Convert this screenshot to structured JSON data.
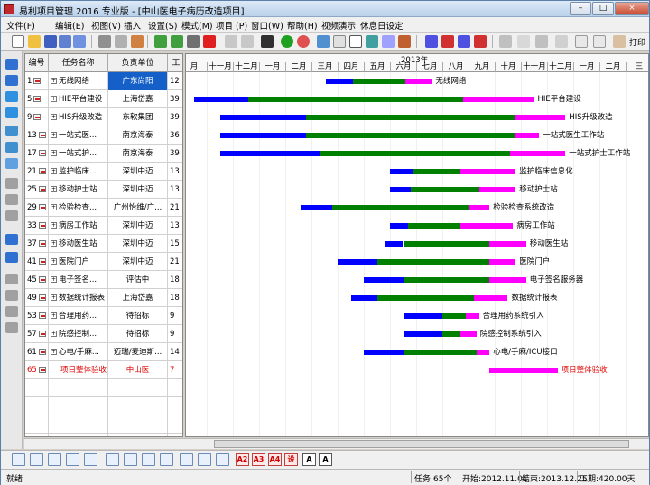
{
  "window": {
    "title": "易利项目管理 2016 专业版 - [中山医电子病历改造项目]",
    "controls": [
      "–",
      "□",
      "×"
    ]
  },
  "menu": [
    "文件(F)",
    "编辑(E)",
    "视图(V)",
    "插入",
    "设置(S)",
    "模式(M)",
    "项目 (P)",
    "窗口(W)",
    "帮助(H)",
    "视频演示",
    "休息日设定"
  ],
  "toolbar": {
    "print_label": "打印"
  },
  "grid": {
    "headers": {
      "id": "编号",
      "name": "任务名称",
      "unit": "负责单位",
      "duration": "工"
    },
    "rows": [
      {
        "id": "1",
        "name": "无线网络",
        "unit": "广东尚阳",
        "duration": "12",
        "selected": true
      },
      {
        "id": "5",
        "name": "HIE平台建设",
        "unit": "上海岱嘉",
        "duration": "39"
      },
      {
        "id": "9",
        "name": "HIS升级改造",
        "unit": "东软集团",
        "duration": "39"
      },
      {
        "id": "13",
        "name": "一站式医...",
        "unit": "南京海泰",
        "duration": "36"
      },
      {
        "id": "17",
        "name": "一站式护...",
        "unit": "南京海泰",
        "duration": "39"
      },
      {
        "id": "21",
        "name": "监护临床...",
        "unit": "深圳中迈",
        "duration": "13"
      },
      {
        "id": "25",
        "name": "移动护士站",
        "unit": "深圳中迈",
        "duration": "13"
      },
      {
        "id": "29",
        "name": "检验检查...",
        "unit": "广州怡维/广...",
        "duration": "21"
      },
      {
        "id": "33",
        "name": "病房工作站",
        "unit": "深圳中迈",
        "duration": "13"
      },
      {
        "id": "37",
        "name": "移动医生站",
        "unit": "深圳中迈",
        "duration": "15"
      },
      {
        "id": "41",
        "name": "医院门户",
        "unit": "深圳中迈",
        "duration": "21"
      },
      {
        "id": "45",
        "name": "电子签名...",
        "unit": "评估中",
        "duration": "18"
      },
      {
        "id": "49",
        "name": "数据统计报表",
        "unit": "上海岱嘉",
        "duration": "18"
      },
      {
        "id": "53",
        "name": "合理用药...",
        "unit": "待招标",
        "duration": "9"
      },
      {
        "id": "57",
        "name": "院感控制...",
        "unit": "待招标",
        "duration": "9"
      },
      {
        "id": "61",
        "name": "心电/手麻...",
        "unit": "迈瑞/麦迪斯...",
        "duration": "14"
      },
      {
        "id": "65",
        "name": "项目整体验收",
        "unit": "中山医",
        "duration": "7",
        "red": true
      }
    ]
  },
  "gantt": {
    "year_label": "2013年",
    "months": [
      "月",
      "十一月",
      "十二月",
      "一月",
      "二月",
      "三月",
      "四月",
      "五月",
      "六月",
      "七月",
      "八月",
      "九月",
      "十月",
      "十一月",
      "十二月",
      "一月",
      "二月",
      "三"
    ],
    "colors": {
      "blue": "#0000ff",
      "green": "#008000",
      "magenta": "#ff00ff"
    },
    "tasks": [
      {
        "label": "无线网络",
        "segments": [
          {
            "start": 5.55,
            "end": 6.6,
            "color": "blue"
          },
          {
            "start": 6.6,
            "end": 8.6,
            "color": "green"
          },
          {
            "start": 8.6,
            "end": 9.6,
            "color": "magenta"
          }
        ]
      },
      {
        "label": "HIE平台建设",
        "segments": [
          {
            "start": 0.5,
            "end": 2.6,
            "color": "blue"
          },
          {
            "start": 2.6,
            "end": 10.8,
            "color": "green"
          },
          {
            "start": 10.8,
            "end": 13.5,
            "color": "magenta"
          }
        ]
      },
      {
        "label": "HIS升级改造",
        "segments": [
          {
            "start": 1.5,
            "end": 4.8,
            "color": "blue"
          },
          {
            "start": 4.8,
            "end": 12.8,
            "color": "green"
          },
          {
            "start": 12.8,
            "end": 14.7,
            "color": "magenta"
          }
        ]
      },
      {
        "label": "一站式医生工作站",
        "segments": [
          {
            "start": 1.5,
            "end": 4.8,
            "color": "blue"
          },
          {
            "start": 4.8,
            "end": 12.8,
            "color": "green"
          },
          {
            "start": 12.8,
            "end": 13.7,
            "color": "magenta"
          }
        ]
      },
      {
        "label": "一站式护士工作站",
        "segments": [
          {
            "start": 1.5,
            "end": 5.3,
            "color": "blue"
          },
          {
            "start": 5.3,
            "end": 12.6,
            "color": "green"
          },
          {
            "start": 12.6,
            "end": 14.7,
            "color": "magenta"
          }
        ]
      },
      {
        "label": "监护临床信息化",
        "segments": [
          {
            "start": 8.0,
            "end": 8.9,
            "color": "blue"
          },
          {
            "start": 8.9,
            "end": 10.7,
            "color": "green"
          },
          {
            "start": 10.7,
            "end": 12.8,
            "color": "magenta"
          }
        ]
      },
      {
        "label": "移动护士站",
        "segments": [
          {
            "start": 8.0,
            "end": 8.8,
            "color": "blue"
          },
          {
            "start": 8.8,
            "end": 11.4,
            "color": "green"
          },
          {
            "start": 11.4,
            "end": 12.8,
            "color": "magenta"
          }
        ]
      },
      {
        "label": "检验检查系统改造",
        "segments": [
          {
            "start": 4.6,
            "end": 5.8,
            "color": "blue"
          },
          {
            "start": 5.8,
            "end": 11.0,
            "color": "green"
          },
          {
            "start": 11.0,
            "end": 11.8,
            "color": "magenta"
          }
        ]
      },
      {
        "label": "病房工作站",
        "segments": [
          {
            "start": 8.0,
            "end": 8.7,
            "color": "blue"
          },
          {
            "start": 8.7,
            "end": 10.7,
            "color": "green"
          },
          {
            "start": 10.7,
            "end": 12.7,
            "color": "magenta"
          }
        ]
      },
      {
        "label": "移动医生站",
        "segments": [
          {
            "start": 7.8,
            "end": 8.5,
            "color": "blue"
          },
          {
            "start": 8.5,
            "end": 11.8,
            "color": "green"
          },
          {
            "start": 11.8,
            "end": 13.2,
            "color": "magenta"
          }
        ]
      },
      {
        "label": "医院门户",
        "segments": [
          {
            "start": 6.0,
            "end": 7.5,
            "color": "blue"
          },
          {
            "start": 7.5,
            "end": 11.8,
            "color": "green"
          },
          {
            "start": 11.8,
            "end": 12.8,
            "color": "magenta"
          }
        ]
      },
      {
        "label": "电子签名服务器",
        "segments": [
          {
            "start": 7.0,
            "end": 8.5,
            "color": "blue"
          },
          {
            "start": 8.5,
            "end": 11.8,
            "color": "green"
          },
          {
            "start": 11.8,
            "end": 13.2,
            "color": "magenta"
          }
        ]
      },
      {
        "label": "数据统计报表",
        "segments": [
          {
            "start": 6.5,
            "end": 7.5,
            "color": "blue"
          },
          {
            "start": 7.5,
            "end": 11.2,
            "color": "green"
          },
          {
            "start": 11.2,
            "end": 12.5,
            "color": "magenta"
          }
        ]
      },
      {
        "label": "合理用药系统引入",
        "segments": [
          {
            "start": 8.5,
            "end": 10.0,
            "color": "blue"
          },
          {
            "start": 10.0,
            "end": 10.9,
            "color": "green"
          },
          {
            "start": 10.9,
            "end": 11.4,
            "color": "magenta"
          }
        ]
      },
      {
        "label": "院感控制系统引入",
        "segments": [
          {
            "start": 8.5,
            "end": 10.0,
            "color": "blue"
          },
          {
            "start": 10.0,
            "end": 10.7,
            "color": "green"
          },
          {
            "start": 10.7,
            "end": 11.3,
            "color": "magenta"
          }
        ]
      },
      {
        "label": "心电/手麻/ICU接口",
        "segments": [
          {
            "start": 7.0,
            "end": 8.5,
            "color": "blue"
          },
          {
            "start": 8.5,
            "end": 11.3,
            "color": "green"
          },
          {
            "start": 11.3,
            "end": 11.8,
            "color": "magenta"
          }
        ]
      },
      {
        "label": "项目整体验收",
        "red": true,
        "segments": [
          {
            "start": 11.8,
            "end": 14.4,
            "color": "magenta"
          }
        ]
      }
    ]
  },
  "status": {
    "ready": "就绪",
    "task_count": "任务:65个",
    "start": "开始:2012.11.01",
    "end": "结束:2013.12.25",
    "duration": "工期:420.00天"
  }
}
